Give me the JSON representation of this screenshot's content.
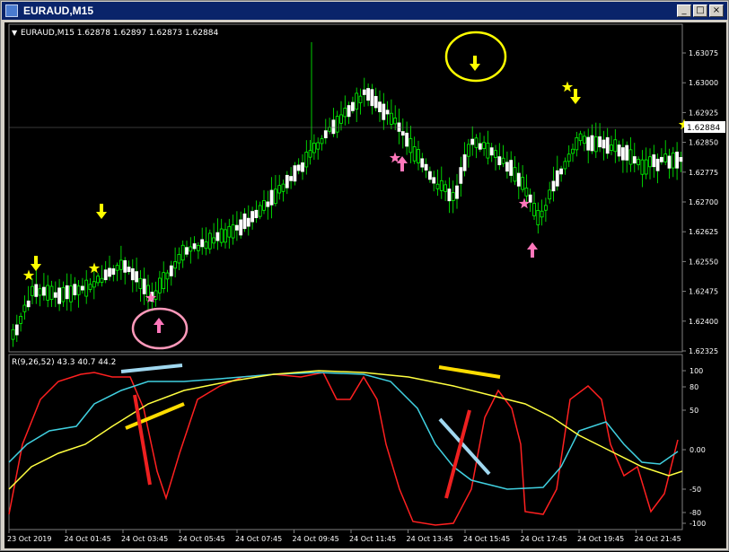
{
  "window": {
    "title": "EURAUD,M15",
    "buttons": [
      "_",
      "□",
      "×"
    ]
  },
  "main_chart": {
    "header": "EURAUD,M15  1.62878 1.62897 1.62873 1.62884",
    "symbol_marker": "▼",
    "price_ticks": [
      "1.63075",
      "1.63000",
      "1.62925",
      "1.62850",
      "1.62775",
      "1.62700",
      "1.62625",
      "1.62550",
      "1.62475",
      "1.62400",
      "1.62325"
    ],
    "current_price": "1.62884",
    "colors": {
      "bull": "#00ff00",
      "bear": "#ffffff",
      "wick": "#00ff00",
      "arrow_down": "#ffff00",
      "arrow_up": "#ff77bb",
      "star_yellow": "#ffff00",
      "star_pink": "#ff77bb"
    }
  },
  "indicator": {
    "header": "R(9,26,52) 43.3 40.7 44.2",
    "level_ticks": [
      "100",
      "80",
      "50",
      "0.00",
      "-50",
      "-80",
      "-100"
    ],
    "colors": {
      "fast": "#ff2020",
      "mid": "#40d0e0",
      "slow": "#ffff40"
    }
  },
  "time_axis": [
    "23 Oct 2019",
    "24 Oct 01:45",
    "24 Oct 03:45",
    "24 Oct 05:45",
    "24 Oct 07:45",
    "24 Oct 09:45",
    "24 Oct 11:45",
    "24 Oct 13:45",
    "24 Oct 15:45",
    "24 Oct 17:45",
    "24 Oct 19:45",
    "24 Oct 21:45"
  ]
}
